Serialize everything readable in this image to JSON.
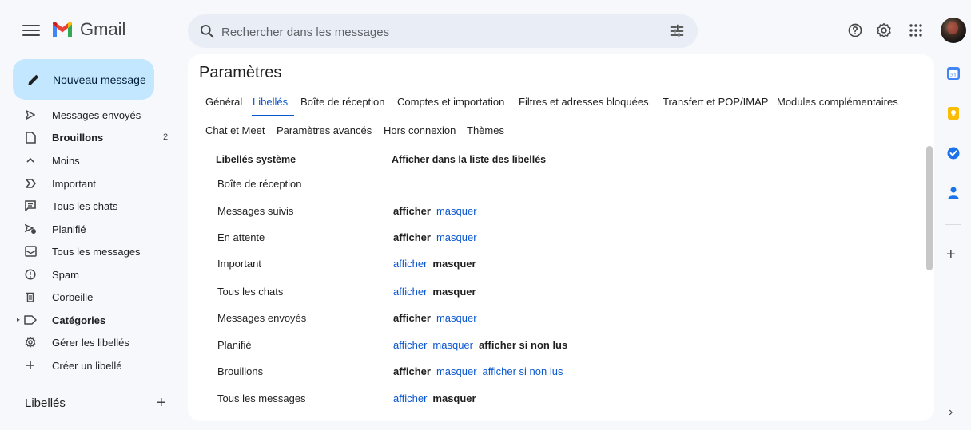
{
  "header": {
    "app_name": "Gmail",
    "search_placeholder": "Rechercher dans les messages"
  },
  "sidebar": {
    "compose_label": "Nouveau message",
    "items": [
      {
        "label": "Messages envoyés",
        "icon": "send-icon",
        "count": ""
      },
      {
        "label": "Brouillons",
        "icon": "draft-icon",
        "count": "2",
        "bold": true
      },
      {
        "label": "Moins",
        "icon": "chevron-up-icon",
        "count": ""
      },
      {
        "label": "Important",
        "icon": "important-icon",
        "count": ""
      },
      {
        "label": "Tous les chats",
        "icon": "chat-icon",
        "count": ""
      },
      {
        "label": "Planifié",
        "icon": "scheduled-send-icon",
        "count": ""
      },
      {
        "label": "Tous les messages",
        "icon": "all-mail-icon",
        "count": ""
      },
      {
        "label": "Spam",
        "icon": "spam-icon",
        "count": ""
      },
      {
        "label": "Corbeille",
        "icon": "trash-icon",
        "count": ""
      },
      {
        "label": "Catégories",
        "icon": "label-icon",
        "count": "",
        "bold": true
      },
      {
        "label": "Gérer les libellés",
        "icon": "gear-icon",
        "count": ""
      },
      {
        "label": "Créer un libellé",
        "icon": "plus-icon",
        "count": ""
      }
    ],
    "labels_title": "Libellés",
    "labels_add": "+"
  },
  "main": {
    "title": "Paramètres",
    "tabs_row1": [
      "Général",
      "Libellés",
      "Boîte de réception",
      "Comptes et importation",
      "Filtres et adresses bloquées",
      "Transfert et POP/IMAP",
      "Modules complémentaires"
    ],
    "tabs_row2": [
      "Chat et Meet",
      "Paramètres avancés",
      "Hors connexion",
      "Thèmes"
    ],
    "active_tab": "Libellés",
    "col_system": "Libellés système",
    "col_show": "Afficher dans la liste des libellés",
    "rows": [
      {
        "label": "Boîte de réception",
        "actions": []
      },
      {
        "label": "Messages suivis",
        "actions": [
          {
            "t": "afficher",
            "on": true
          },
          {
            "t": "masquer",
            "on": false
          }
        ]
      },
      {
        "label": "En attente",
        "actions": [
          {
            "t": "afficher",
            "on": true
          },
          {
            "t": "masquer",
            "on": false
          }
        ]
      },
      {
        "label": "Important",
        "actions": [
          {
            "t": "afficher",
            "on": false
          },
          {
            "t": "masquer",
            "on": true
          }
        ]
      },
      {
        "label": "Tous les chats",
        "actions": [
          {
            "t": "afficher",
            "on": false
          },
          {
            "t": "masquer",
            "on": true
          }
        ]
      },
      {
        "label": "Messages envoyés",
        "actions": [
          {
            "t": "afficher",
            "on": true
          },
          {
            "t": "masquer",
            "on": false
          }
        ]
      },
      {
        "label": "Planifié",
        "actions": [
          {
            "t": "afficher",
            "on": false
          },
          {
            "t": "masquer",
            "on": false
          },
          {
            "t": "afficher si non lus",
            "on": true
          }
        ]
      },
      {
        "label": "Brouillons",
        "actions": [
          {
            "t": "afficher",
            "on": true
          },
          {
            "t": "masquer",
            "on": false
          },
          {
            "t": "afficher si non lus",
            "on": false
          }
        ]
      },
      {
        "label": "Tous les messages",
        "actions": [
          {
            "t": "afficher",
            "on": false
          },
          {
            "t": "masquer",
            "on": true
          }
        ]
      }
    ]
  },
  "colors": {
    "accent": "#0b57d0",
    "compose_bg": "#c2e7ff",
    "page_bg": "#f6f8fc"
  }
}
